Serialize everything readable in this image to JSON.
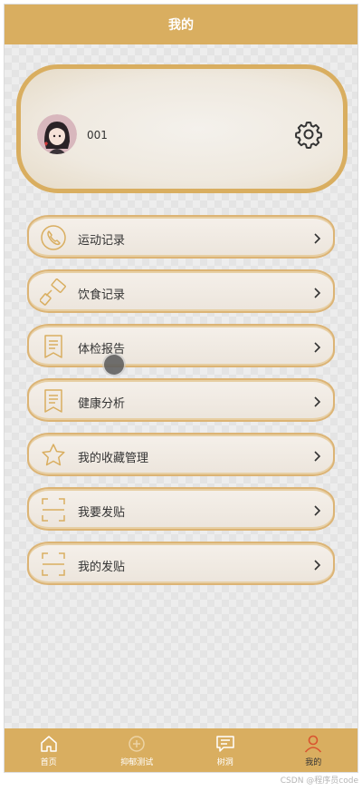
{
  "header": {
    "title": "我的"
  },
  "profile": {
    "username": "001"
  },
  "menu": [
    {
      "label": "运动记录",
      "icon": "phone-icon"
    },
    {
      "label": "饮食记录",
      "icon": "paint-roller-icon"
    },
    {
      "label": "体检报告",
      "icon": "document-icon"
    },
    {
      "label": "健康分析",
      "icon": "document-icon"
    },
    {
      "label": "我的收藏管理",
      "icon": "star-icon"
    },
    {
      "label": "我要发贴",
      "icon": "scan-icon"
    },
    {
      "label": "我的发贴",
      "icon": "scan-icon"
    }
  ],
  "tabbar": [
    {
      "label": "首页",
      "icon": "home-icon",
      "active": false
    },
    {
      "label": "抑郁测试",
      "icon": "test-icon",
      "active": false
    },
    {
      "label": "树洞",
      "icon": "message-icon",
      "active": false
    },
    {
      "label": "我的",
      "icon": "user-icon",
      "active": true
    }
  ],
  "watermark": "CSDN @程序员code",
  "colors": {
    "accent": "#d9ae60",
    "active_tab_icon": "#d9532f"
  }
}
